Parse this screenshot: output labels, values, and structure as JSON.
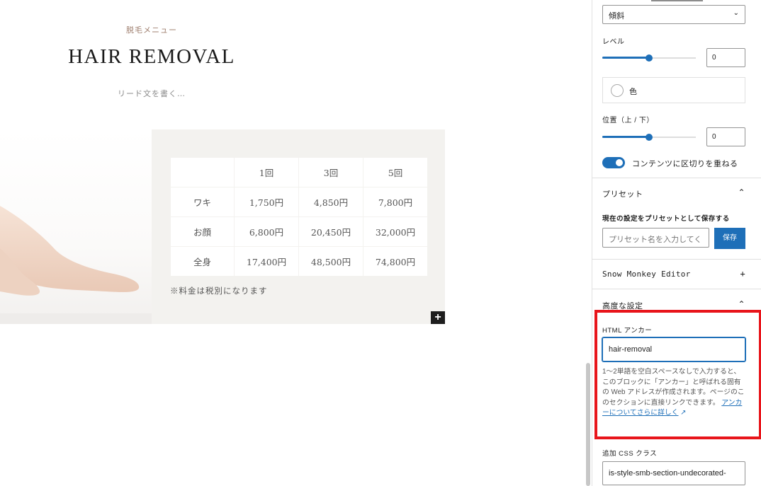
{
  "canvas": {
    "sub_heading": "脱毛メニュー",
    "heading": "HAIR REMOVAL",
    "lead": "リード文を書く…",
    "price_table": {
      "header": [
        "",
        "1回",
        "3回",
        "5回"
      ],
      "rows": [
        [
          "ワキ",
          "1,750円",
          "4,850円",
          "7,800円"
        ],
        [
          "お顔",
          "6,800円",
          "20,450円",
          "32,000円"
        ],
        [
          "全身",
          "17,400円",
          "48,500円",
          "74,800円"
        ]
      ]
    },
    "note": "※料金は税別になります",
    "add_block_label": "+"
  },
  "sidebar": {
    "divider_style_select": "傾斜",
    "level_label": "レベル",
    "level_value": "0",
    "level_fraction": 0.5,
    "color_label": "色",
    "position_label": "位置（上 / 下）",
    "position_value": "0",
    "position_fraction": 0.5,
    "overlap_toggle_label": "コンテンツに区切りを重ねる",
    "overlap_toggle_on": true,
    "preset": {
      "title": "プリセット",
      "save_label": "現在の設定をプリセットとして保存する",
      "input_placeholder": "プリセット名を入力してく",
      "save_button": "保存"
    },
    "snow_monkey_editor": "Snow Monkey Editor",
    "advanced": {
      "title": "高度な設定",
      "anchor_label": "HTML アンカー",
      "anchor_value": "hair-removal",
      "help_text": "1〜2単語を空白スペースなしで入力すると、このブロックに「アンカー」と呼ばれる固有の Web アドレスが作成されます。ページのこのセクションに直接リンクできます。",
      "help_link": "アンカーについてさらに詳しく",
      "css_label": "追加 CSS クラス",
      "css_value": "is-style-smb-section-undecorated-"
    },
    "icons": {
      "chevron_down": "⌄",
      "chevron_up": "⌃",
      "plus": "+",
      "external": "↗"
    },
    "accent_color": "#1e6fb8",
    "highlight_color": "#e8151b"
  }
}
